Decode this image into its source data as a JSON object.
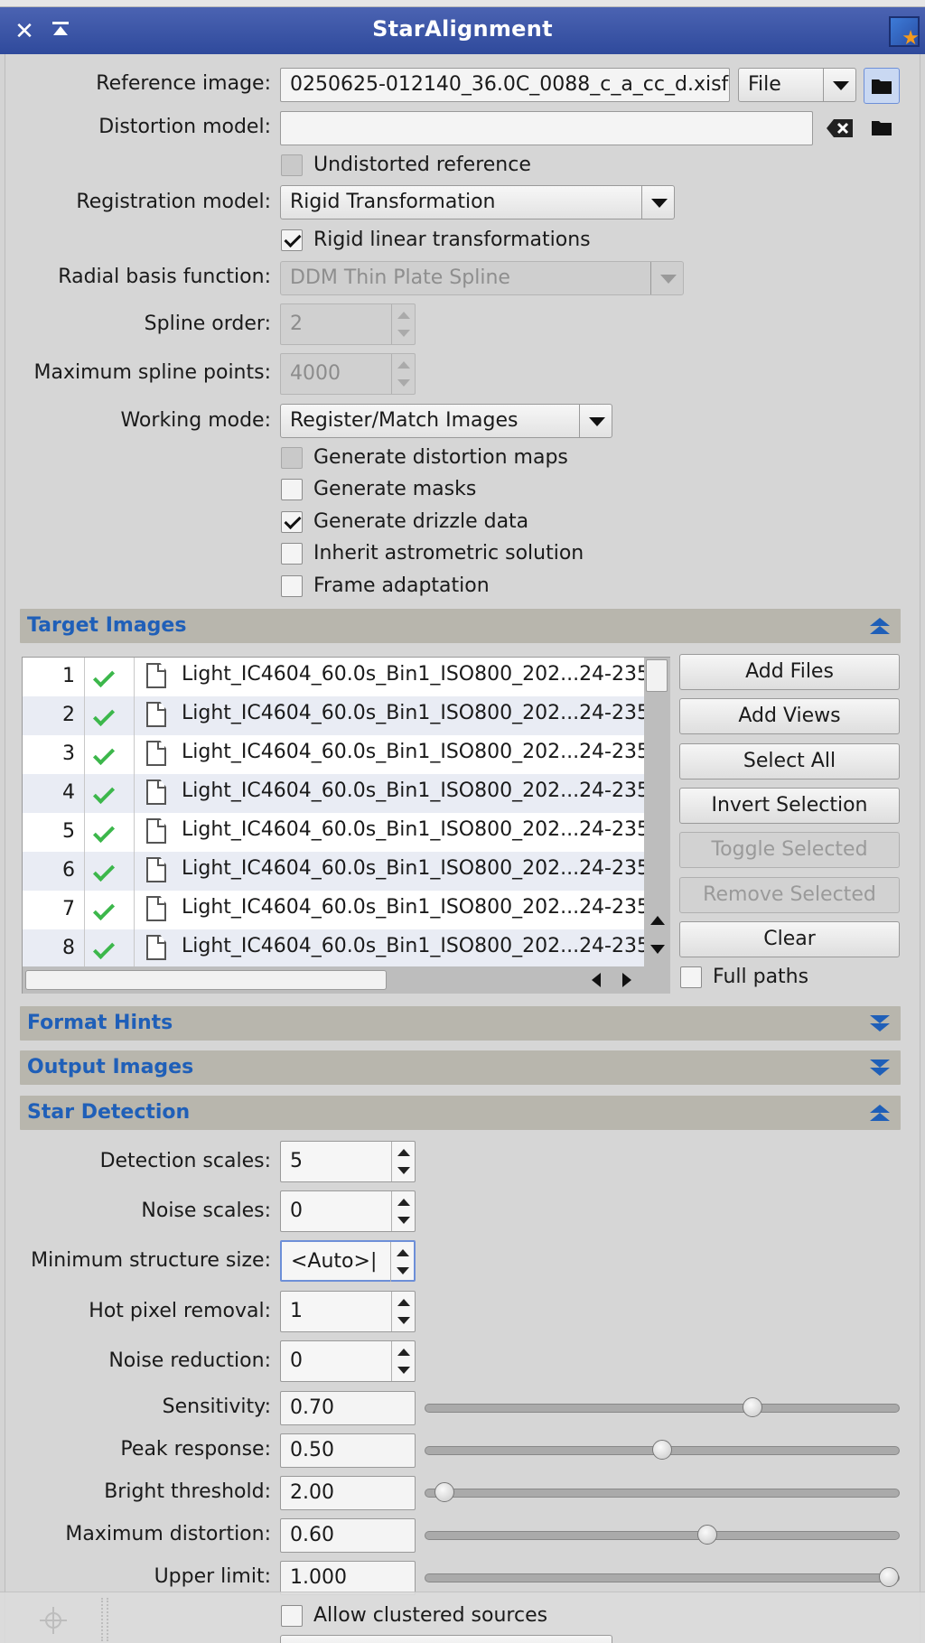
{
  "window": {
    "title": "StarAlignment"
  },
  "form": {
    "reference_image": {
      "label": "Reference image:",
      "value": "0250625-012140_36.0C_0088_c_a_cc_d.xisf",
      "source": "File"
    },
    "distortion_model": {
      "label": "Distortion model:",
      "value": ""
    },
    "undistorted_reference": {
      "label": "Undistorted reference",
      "checked": false
    },
    "registration_model": {
      "label": "Registration model:",
      "value": "Rigid Transformation"
    },
    "rigid_linear": {
      "label": "Rigid linear transformations",
      "checked": true
    },
    "radial_basis": {
      "label": "Radial basis function:",
      "value": "DDM Thin Plate Spline"
    },
    "spline_order": {
      "label": "Spline order:",
      "value": "2"
    },
    "max_spline_points": {
      "label": "Maximum spline points:",
      "value": "4000"
    },
    "working_mode": {
      "label": "Working mode:",
      "value": "Register/Match Images"
    },
    "gen_distortion_maps": {
      "label": "Generate distortion maps",
      "checked": false
    },
    "gen_masks": {
      "label": "Generate masks",
      "checked": false
    },
    "gen_drizzle": {
      "label": "Generate drizzle data",
      "checked": true
    },
    "inherit_astrometric": {
      "label": "Inherit astrometric solution",
      "checked": false
    },
    "frame_adaptation": {
      "label": "Frame adaptation",
      "checked": false
    }
  },
  "sections": {
    "target_images": "Target Images",
    "format_hints": "Format Hints",
    "output_images": "Output Images",
    "star_detection": "Star Detection"
  },
  "target_images": {
    "rows": [
      {
        "num": "1",
        "file": "Light_IC4604_60.0s_Bin1_ISO800_202...24-235"
      },
      {
        "num": "2",
        "file": "Light_IC4604_60.0s_Bin1_ISO800_202...24-235"
      },
      {
        "num": "3",
        "file": "Light_IC4604_60.0s_Bin1_ISO800_202...24-235"
      },
      {
        "num": "4",
        "file": "Light_IC4604_60.0s_Bin1_ISO800_202...24-235"
      },
      {
        "num": "5",
        "file": "Light_IC4604_60.0s_Bin1_ISO800_202...24-235"
      },
      {
        "num": "6",
        "file": "Light_IC4604_60.0s_Bin1_ISO800_202...24-235"
      },
      {
        "num": "7",
        "file": "Light_IC4604_60.0s_Bin1_ISO800_202...24-235"
      },
      {
        "num": "8",
        "file": "Light_IC4604_60.0s_Bin1_ISO800_202...24-235"
      }
    ],
    "buttons": {
      "add_files": "Add Files",
      "add_views": "Add Views",
      "select_all": "Select All",
      "invert_selection": "Invert Selection",
      "toggle_selected": "Toggle Selected",
      "remove_selected": "Remove Selected",
      "clear": "Clear"
    },
    "full_paths": {
      "label": "Full paths",
      "checked": false
    }
  },
  "star_detection": {
    "detection_scales": {
      "label": "Detection scales:",
      "value": "5"
    },
    "noise_scales": {
      "label": "Noise scales:",
      "value": "0"
    },
    "min_structure_size": {
      "label": "Minimum structure size:",
      "value": "<Auto>|"
    },
    "hot_pixel_removal": {
      "label": "Hot pixel removal:",
      "value": "1"
    },
    "noise_reduction": {
      "label": "Noise reduction:",
      "value": "0"
    },
    "sensitivity": {
      "label": "Sensitivity:",
      "value": "0.70",
      "level": 0.7
    },
    "peak_response": {
      "label": "Peak response:",
      "value": "0.50",
      "level": 0.5
    },
    "bright_threshold": {
      "label": "Bright threshold:",
      "value": "2.00",
      "level": 0.02
    },
    "max_distortion": {
      "label": "Maximum distortion:",
      "value": "0.60",
      "level": 0.6
    },
    "upper_limit": {
      "label": "Upper limit:",
      "value": "1.000",
      "level": 1.0
    },
    "allow_clustered": {
      "label": "Allow clustered sources",
      "checked": false
    }
  },
  "icons": [
    "close-icon",
    "shade-icon",
    "app-icon",
    "folder-icon",
    "clear-icon",
    "dropdown-arrow-icon",
    "checkmark-icon",
    "file-icon",
    "collapse-icon",
    "expand-icon"
  ]
}
